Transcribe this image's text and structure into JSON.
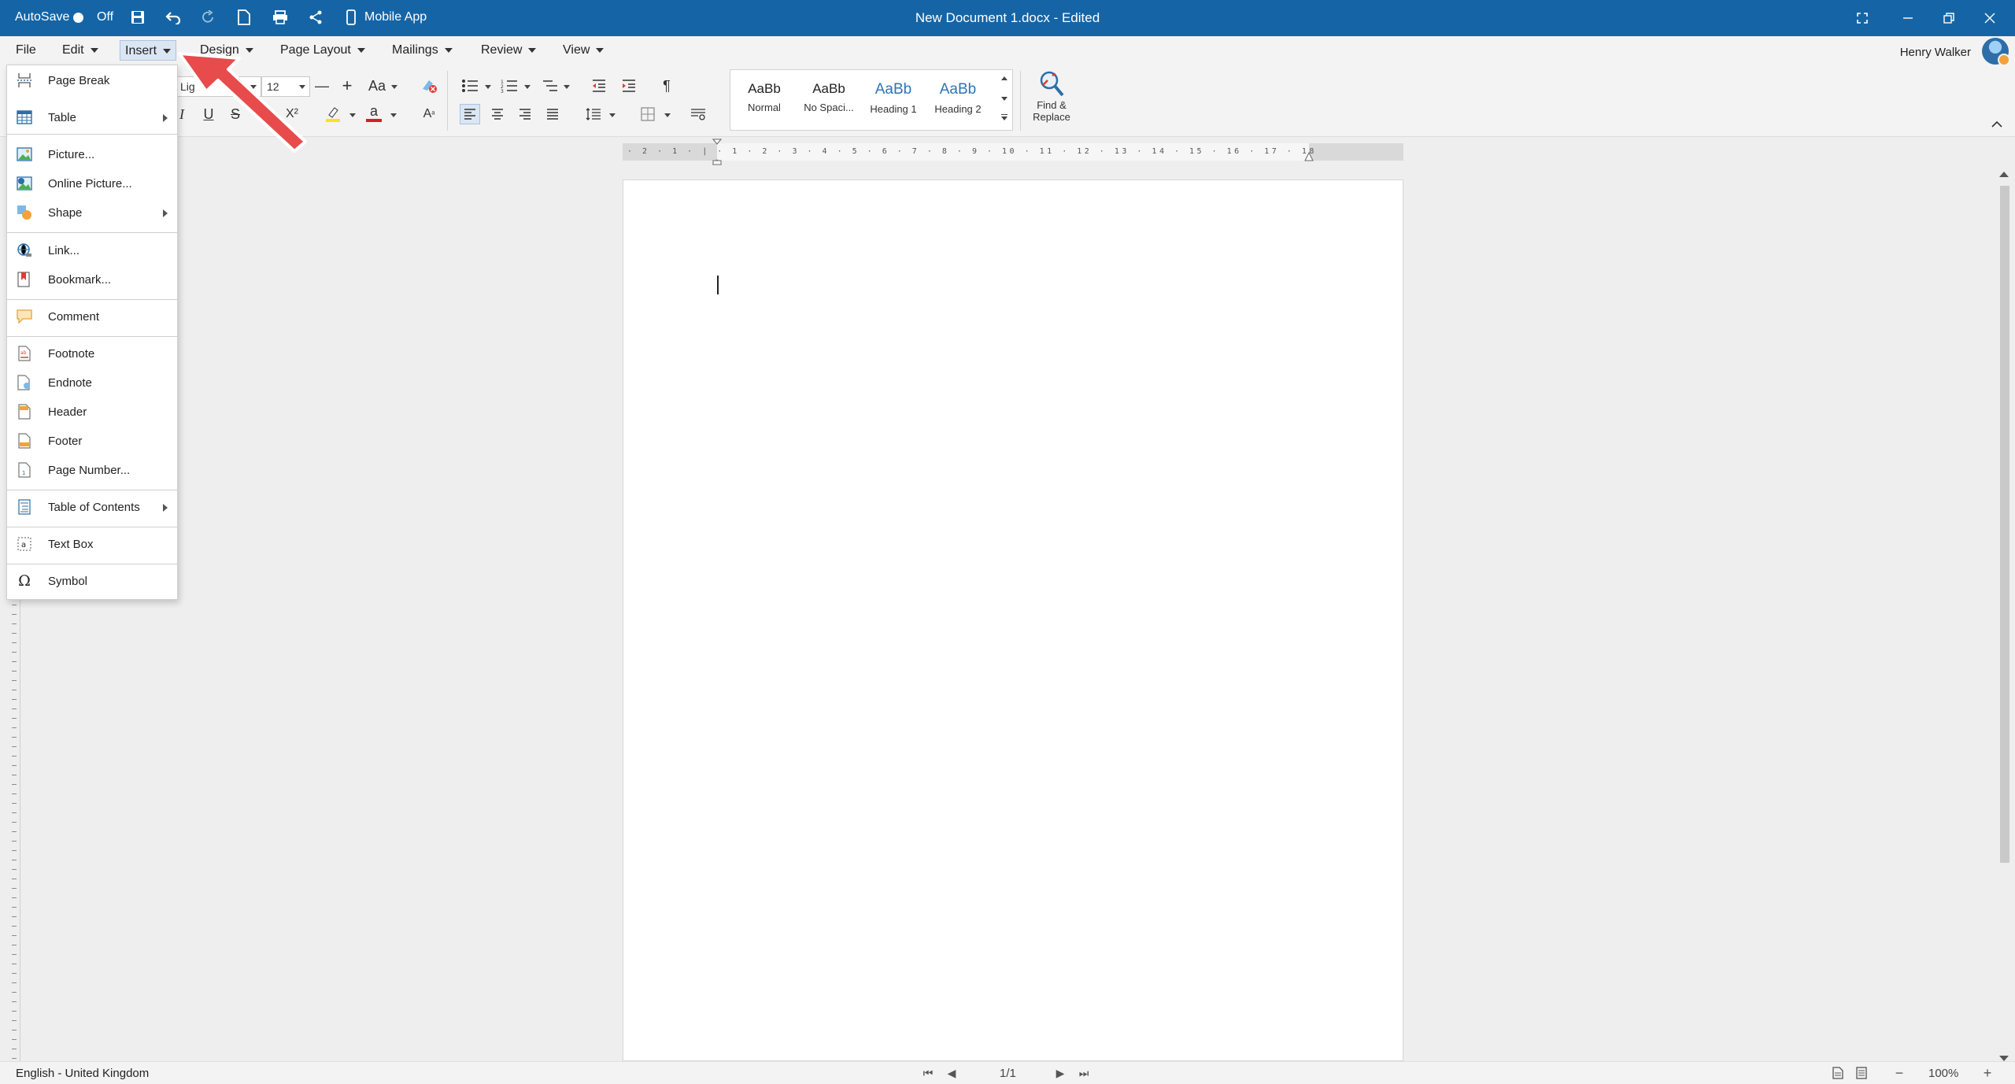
{
  "titlebar": {
    "autosave_label": "AutoSave",
    "autosave_state": "Off",
    "mobile_app_label": "Mobile App",
    "document_title": "New Document 1.docx - Edited"
  },
  "menubar": {
    "items": [
      {
        "label": "File"
      },
      {
        "label": "Edit"
      },
      {
        "label": "Insert"
      },
      {
        "label": "Design"
      },
      {
        "label": "Page Layout"
      },
      {
        "label": "Mailings"
      },
      {
        "label": "Review"
      },
      {
        "label": "View"
      }
    ],
    "active": "Insert",
    "user_name": "Henry Walker"
  },
  "ribbon": {
    "font_name": "Lig",
    "font_size": "12",
    "change_case_label": "Aa",
    "styles": [
      {
        "sample": "AaBb",
        "name": "Normal"
      },
      {
        "sample": "AaBb",
        "name": "No Spaci..."
      },
      {
        "sample": "AaBb",
        "name": "Heading 1"
      },
      {
        "sample": "AaBb",
        "name": "Heading 2"
      }
    ],
    "find_replace_line1": "Find &",
    "find_replace_line2": "Replace",
    "underline_label": "U",
    "strike_label": "S",
    "italic_label": "I",
    "superscript_label": "X²",
    "font_color_label": "a",
    "pilcrow": "¶"
  },
  "ruler": {
    "labels": "· 2 · 1 · | · 1 · 2 · 3 · 4 · 5 · 6 · 7 · 8 · 9 · 10 · 11 · 12 · 13 · 14 · 15 · 16 · 17 · 18"
  },
  "insert_menu": {
    "items": [
      {
        "label": "Page Break",
        "icon": "page-break-icon"
      },
      {
        "label": "Table",
        "icon": "table-icon",
        "submenu": true
      },
      {
        "label": "Picture...",
        "icon": "picture-icon"
      },
      {
        "label": "Online Picture...",
        "icon": "online-picture-icon"
      },
      {
        "label": "Shape",
        "icon": "shape-icon",
        "submenu": true
      },
      {
        "label": "Link...",
        "icon": "link-icon"
      },
      {
        "label": "Bookmark...",
        "icon": "bookmark-icon"
      },
      {
        "label": "Comment",
        "icon": "comment-icon"
      },
      {
        "label": "Footnote",
        "icon": "footnote-icon"
      },
      {
        "label": "Endnote",
        "icon": "endnote-icon"
      },
      {
        "label": "Header",
        "icon": "header-icon"
      },
      {
        "label": "Footer",
        "icon": "footer-icon"
      },
      {
        "label": "Page Number...",
        "icon": "page-number-icon"
      },
      {
        "label": "Table of Contents",
        "icon": "table-of-contents-icon",
        "submenu": true
      },
      {
        "label": "Text Box",
        "icon": "text-box-icon"
      },
      {
        "label": "Symbol",
        "icon": "symbol-icon"
      }
    ]
  },
  "statusbar": {
    "language": "English - United Kingdom",
    "page_indicator": "1/1",
    "zoom": "100%"
  },
  "colors": {
    "title_bar": "#1565a6",
    "annotation_arrow": "#e84b4b",
    "highlight_yellow": "#f5e51b",
    "font_color_red": "#d42020"
  }
}
